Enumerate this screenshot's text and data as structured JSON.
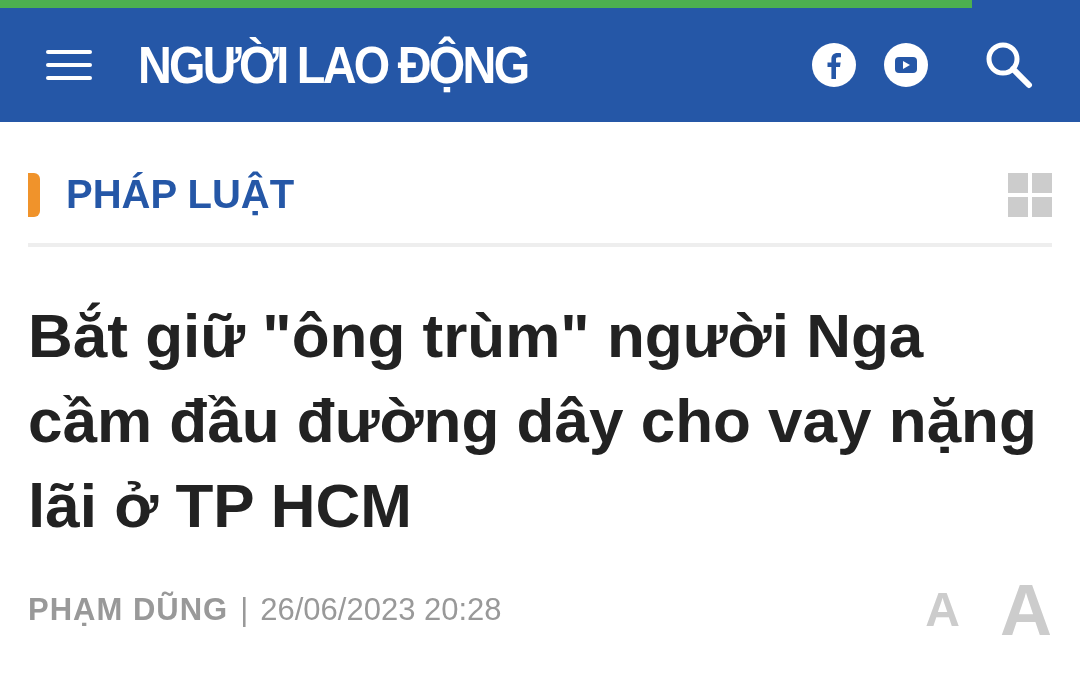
{
  "reading_progress": {
    "level": 0.9
  },
  "header": {
    "logo": "NGƯỜI LAO ĐỘNG"
  },
  "category": {
    "label": "PHÁP LUẬT"
  },
  "article": {
    "title": "Bắt giữ \"ông trùm\" người Nga cầm đầu đường dây cho vay nặng lãi ở TP HCM",
    "author": "PHẠM DŨNG",
    "separator": "|",
    "date": "26/06/2023 20:28"
  },
  "font_size_buttons": [
    {
      "label": "A",
      "kind": "small"
    },
    {
      "label": "A",
      "kind": "large"
    }
  ]
}
